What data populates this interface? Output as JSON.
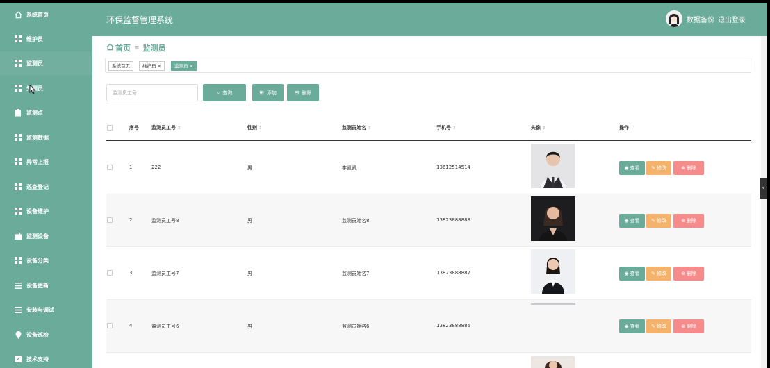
{
  "colors": {
    "primary": "#6aab99",
    "edit": "#f5b26b",
    "delete": "#f58b8b"
  },
  "sidebar": {
    "items": [
      {
        "label": "系统首页",
        "icon": "home-icon"
      },
      {
        "label": "维护员",
        "icon": "grid-icon"
      },
      {
        "label": "监测员",
        "icon": "grid-icon"
      },
      {
        "label": "外测员",
        "icon": "grid-icon"
      },
      {
        "label": "监测点",
        "icon": "clipboard-icon"
      },
      {
        "label": "监测数据",
        "icon": "grid-icon"
      },
      {
        "label": "异常上报",
        "icon": "grid-icon"
      },
      {
        "label": "巡查登记",
        "icon": "grid-icon"
      },
      {
        "label": "设备维护",
        "icon": "grid-icon"
      },
      {
        "label": "监测设备",
        "icon": "briefcase-icon"
      },
      {
        "label": "设备分类",
        "icon": "grid-icon"
      },
      {
        "label": "设备更新",
        "icon": "list-icon"
      },
      {
        "label": "安装与调试",
        "icon": "list-icon"
      },
      {
        "label": "设备巡检",
        "icon": "location-icon"
      },
      {
        "label": "技术支持",
        "icon": "edit-icon"
      }
    ]
  },
  "header": {
    "title": "环保监督管理系统",
    "backup": "数据备份",
    "logout": "退出登录"
  },
  "breadcrumb": {
    "home": "首页",
    "separator": "≡",
    "current": "监测员"
  },
  "tags": [
    {
      "label": "系统首页"
    },
    {
      "label": "维护员 ×"
    },
    {
      "label": "监测员 ×"
    }
  ],
  "search": {
    "placeholder": "监测员工号",
    "query_label": "查询",
    "add_label": "添加",
    "delete_label": "删除"
  },
  "table": {
    "columns": [
      "序号",
      "监测员工号",
      "性别",
      "监测员姓名",
      "手机号",
      "头像",
      "操作"
    ],
    "rows": [
      {
        "index": "1",
        "id": "222",
        "gender": "男",
        "name": "李凯凯",
        "phone": "13612514514"
      },
      {
        "index": "2",
        "id": "监测员工号8",
        "gender": "男",
        "name": "监测员姓名8",
        "phone": "13823888888"
      },
      {
        "index": "3",
        "id": "监测员工号7",
        "gender": "男",
        "name": "监测员姓名7",
        "phone": "13823888887"
      },
      {
        "index": "4",
        "id": "监测员工号6",
        "gender": "男",
        "name": "监测员姓名6",
        "phone": "13823888886"
      }
    ],
    "actions": {
      "view": "查看",
      "edit": "修改",
      "delete": "删除"
    }
  }
}
